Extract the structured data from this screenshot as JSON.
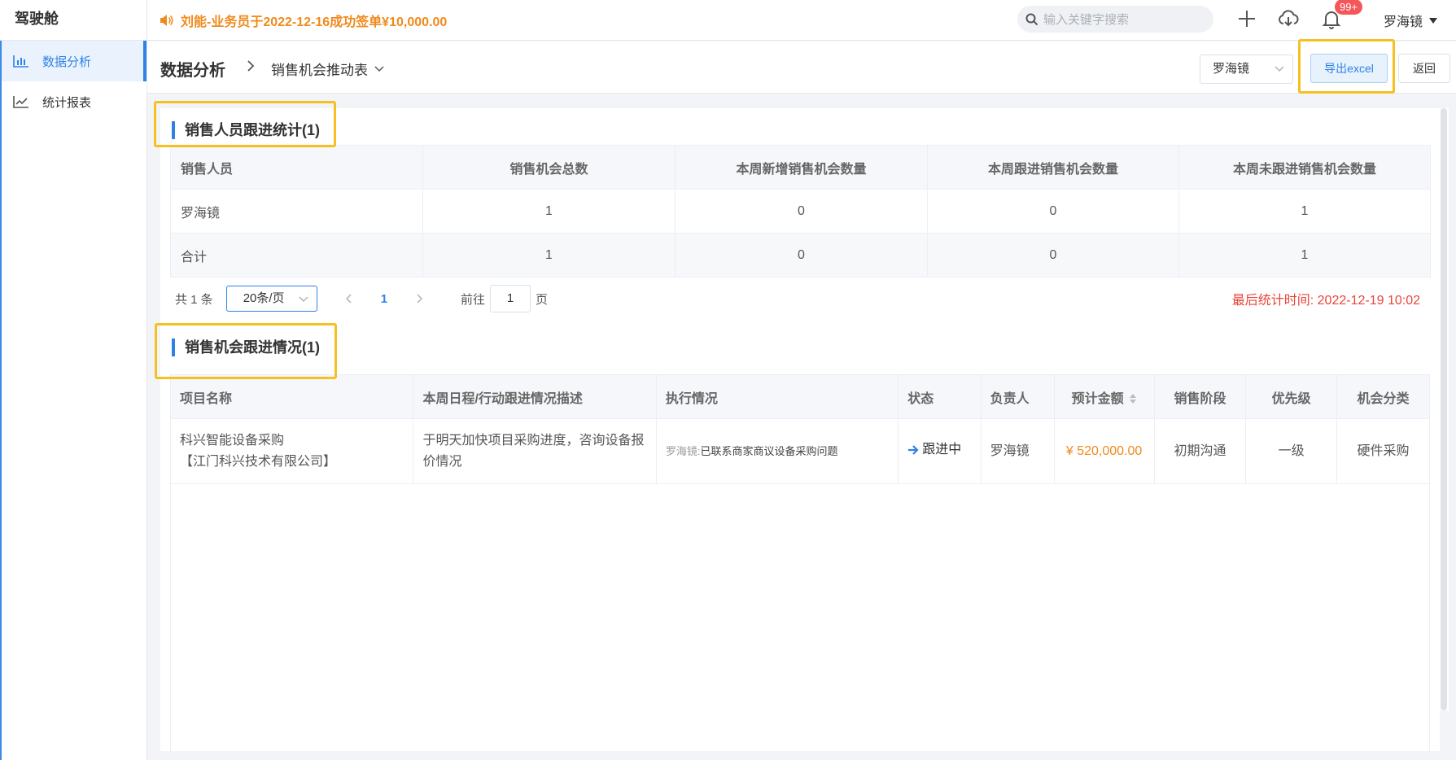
{
  "app": {
    "title": "驾驶舱"
  },
  "notice": {
    "text": "刘能-业务员于2022-12-16成功签单¥10,000.00"
  },
  "search": {
    "placeholder": "输入关键字搜索"
  },
  "notifications": {
    "badge": "99+"
  },
  "user": {
    "name": "罗海镜"
  },
  "sidebar": {
    "items": [
      {
        "label": "数据分析",
        "icon": "bar-chart-icon",
        "active": true
      },
      {
        "label": "统计报表",
        "icon": "line-chart-icon",
        "active": false
      }
    ]
  },
  "header": {
    "title": "数据分析",
    "current": "销售机会推动表",
    "person_select": "罗海镜",
    "export_label": "导出excel",
    "back_label": "返回"
  },
  "stats": {
    "title": "销售人员跟进统计(1)",
    "columns": [
      "销售人员",
      "销售机会总数",
      "本周新增销售机会数量",
      "本周跟进销售机会数量",
      "本周未跟进销售机会数量"
    ],
    "rows": [
      [
        "罗海镜",
        "1",
        "0",
        "0",
        "1"
      ],
      [
        "合计",
        "1",
        "0",
        "0",
        "1"
      ]
    ]
  },
  "pager": {
    "total": "共 1 条",
    "page_size": "20条/页",
    "current_page": "1",
    "goto_label": "前往",
    "goto_value": "1",
    "page_unit": "页",
    "stat_time": "最后统计时间: 2022-12-19 10:02"
  },
  "opps": {
    "title": "销售机会跟进情况(1)",
    "columns": [
      "项目名称",
      "本周日程/行动跟进情况描述",
      "执行情况",
      "状态",
      "负责人",
      "预计金额",
      "销售阶段",
      "优先级",
      "机会分类"
    ],
    "rows": [
      {
        "project": "科兴智能设备采购",
        "company": "【江门科兴技术有限公司】",
        "desc": "于明天加快项目采购进度，咨询设备报价情况",
        "exec_who": "罗海镜:",
        "exec_text": "已联系商家商议设备采购问题",
        "status": "跟进中",
        "owner": "罗海镜",
        "amount": "¥ 520,000.00",
        "stage": "初期沟通",
        "priority": "一级",
        "category": "硬件采购"
      }
    ]
  },
  "colors": {
    "accent": "#2f82e5",
    "warning": "#f08a1c",
    "danger": "#e8443a",
    "highlight": "#f5c020"
  }
}
